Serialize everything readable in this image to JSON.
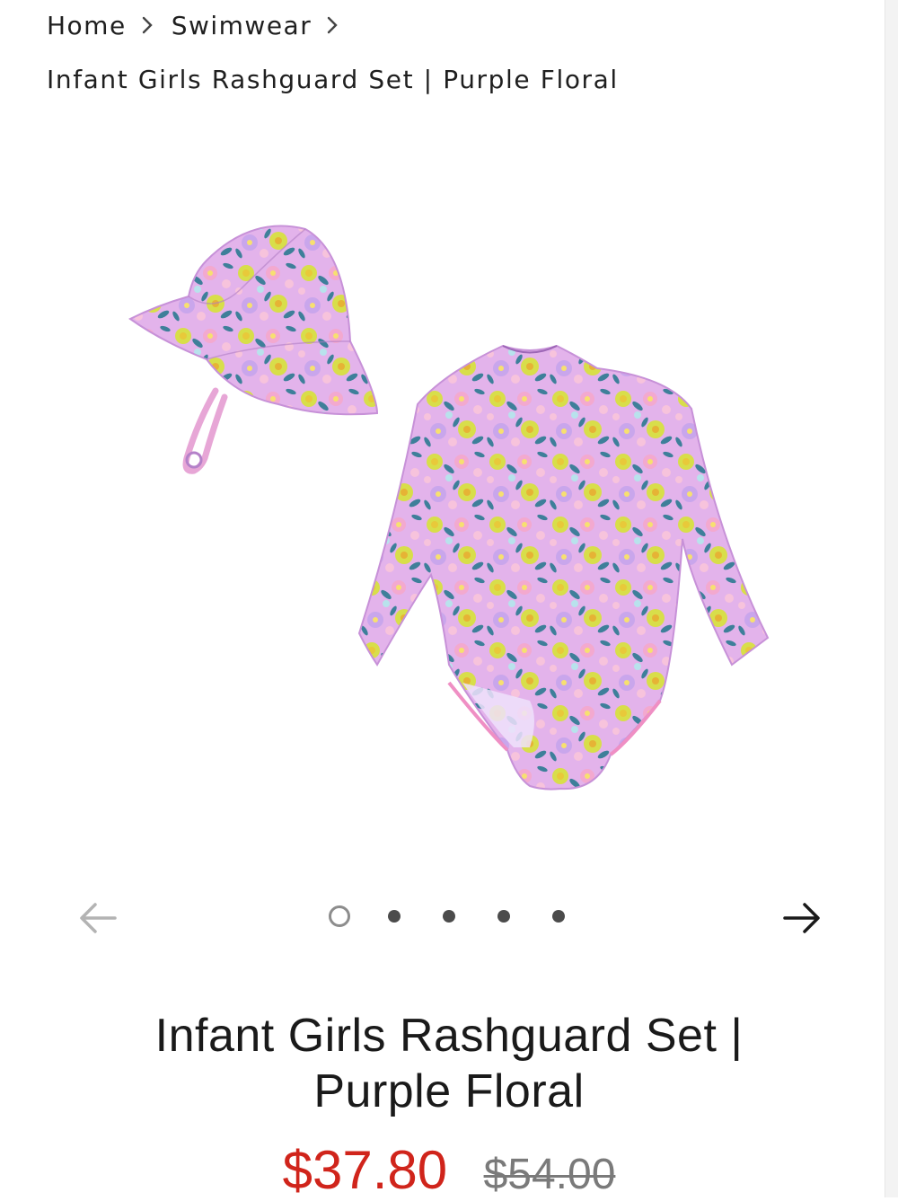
{
  "breadcrumb": {
    "items": [
      "Home",
      "Swimwear"
    ],
    "current": "Infant Girls Rashguard Set | Purple Floral"
  },
  "gallery": {
    "slide_count": 5,
    "active_slide": 1,
    "image_alt": "Infant girls rashguard set with matching sun hat in purple floral print"
  },
  "product": {
    "title": "Infant Girls Rashguard Set | Purple Floral",
    "sale_price": "$37.80",
    "original_price": "$54.00"
  },
  "colors": {
    "sale_price": "#d0241b",
    "fabric_base": "#d9a6e6",
    "flower_yellow": "#d8de4a",
    "leaf_teal": "#3e7f9a",
    "flower_pink": "#f3a9cf"
  },
  "icons": {
    "breadcrumb_separator": "chevron-right-icon",
    "prev": "arrow-left-icon",
    "next": "arrow-right-icon"
  }
}
